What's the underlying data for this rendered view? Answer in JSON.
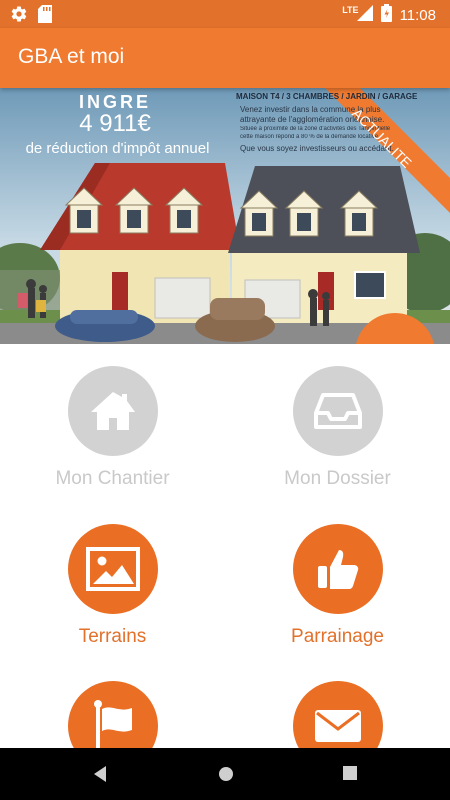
{
  "status_bar": {
    "network": "LTE",
    "time": "11:08",
    "icons": [
      "gear-icon",
      "sd-card-icon",
      "signal-icon",
      "battery-icon"
    ]
  },
  "app_bar": {
    "title": "GBA et moi"
  },
  "banner": {
    "headline": "INGRE",
    "amount": "4 911€",
    "subtitle": "de réduction d'impôt annuel",
    "spec": "MAISON T4 / 3 CHAMBRES / JARDIN / GARAGE",
    "body_line1": "Venez investir dans la commune la plus",
    "body_line2": "attrayante de l'agglomération orléanaise.",
    "fine_line1": "Située à proximité de la zone d'activités des Tangentielle",
    "fine_line2": "cette maison répond à 80 % de la demande locative.",
    "closing": "Que vous soyez investisseurs ou accédant.",
    "ribbon": "ACTUALITE"
  },
  "menu": {
    "items": [
      {
        "label": "Mon Chantier",
        "icon": "house-icon",
        "state": "disabled"
      },
      {
        "label": "Mon Dossier",
        "icon": "inbox-tray-icon",
        "state": "disabled"
      },
      {
        "label": "Terrains",
        "icon": "image-icon",
        "state": "active"
      },
      {
        "label": "Parrainage",
        "icon": "thumbs-up-icon",
        "state": "active"
      },
      {
        "label": "",
        "icon": "flag-icon",
        "state": "active"
      },
      {
        "label": "",
        "icon": "envelope-icon",
        "state": "active"
      }
    ]
  },
  "colors": {
    "status_bar": "#e2712b",
    "app_bar": "#ef7a30",
    "accent": "#ea6f24",
    "disabled": "#d2d2d2",
    "nav_bar": "#000000"
  }
}
